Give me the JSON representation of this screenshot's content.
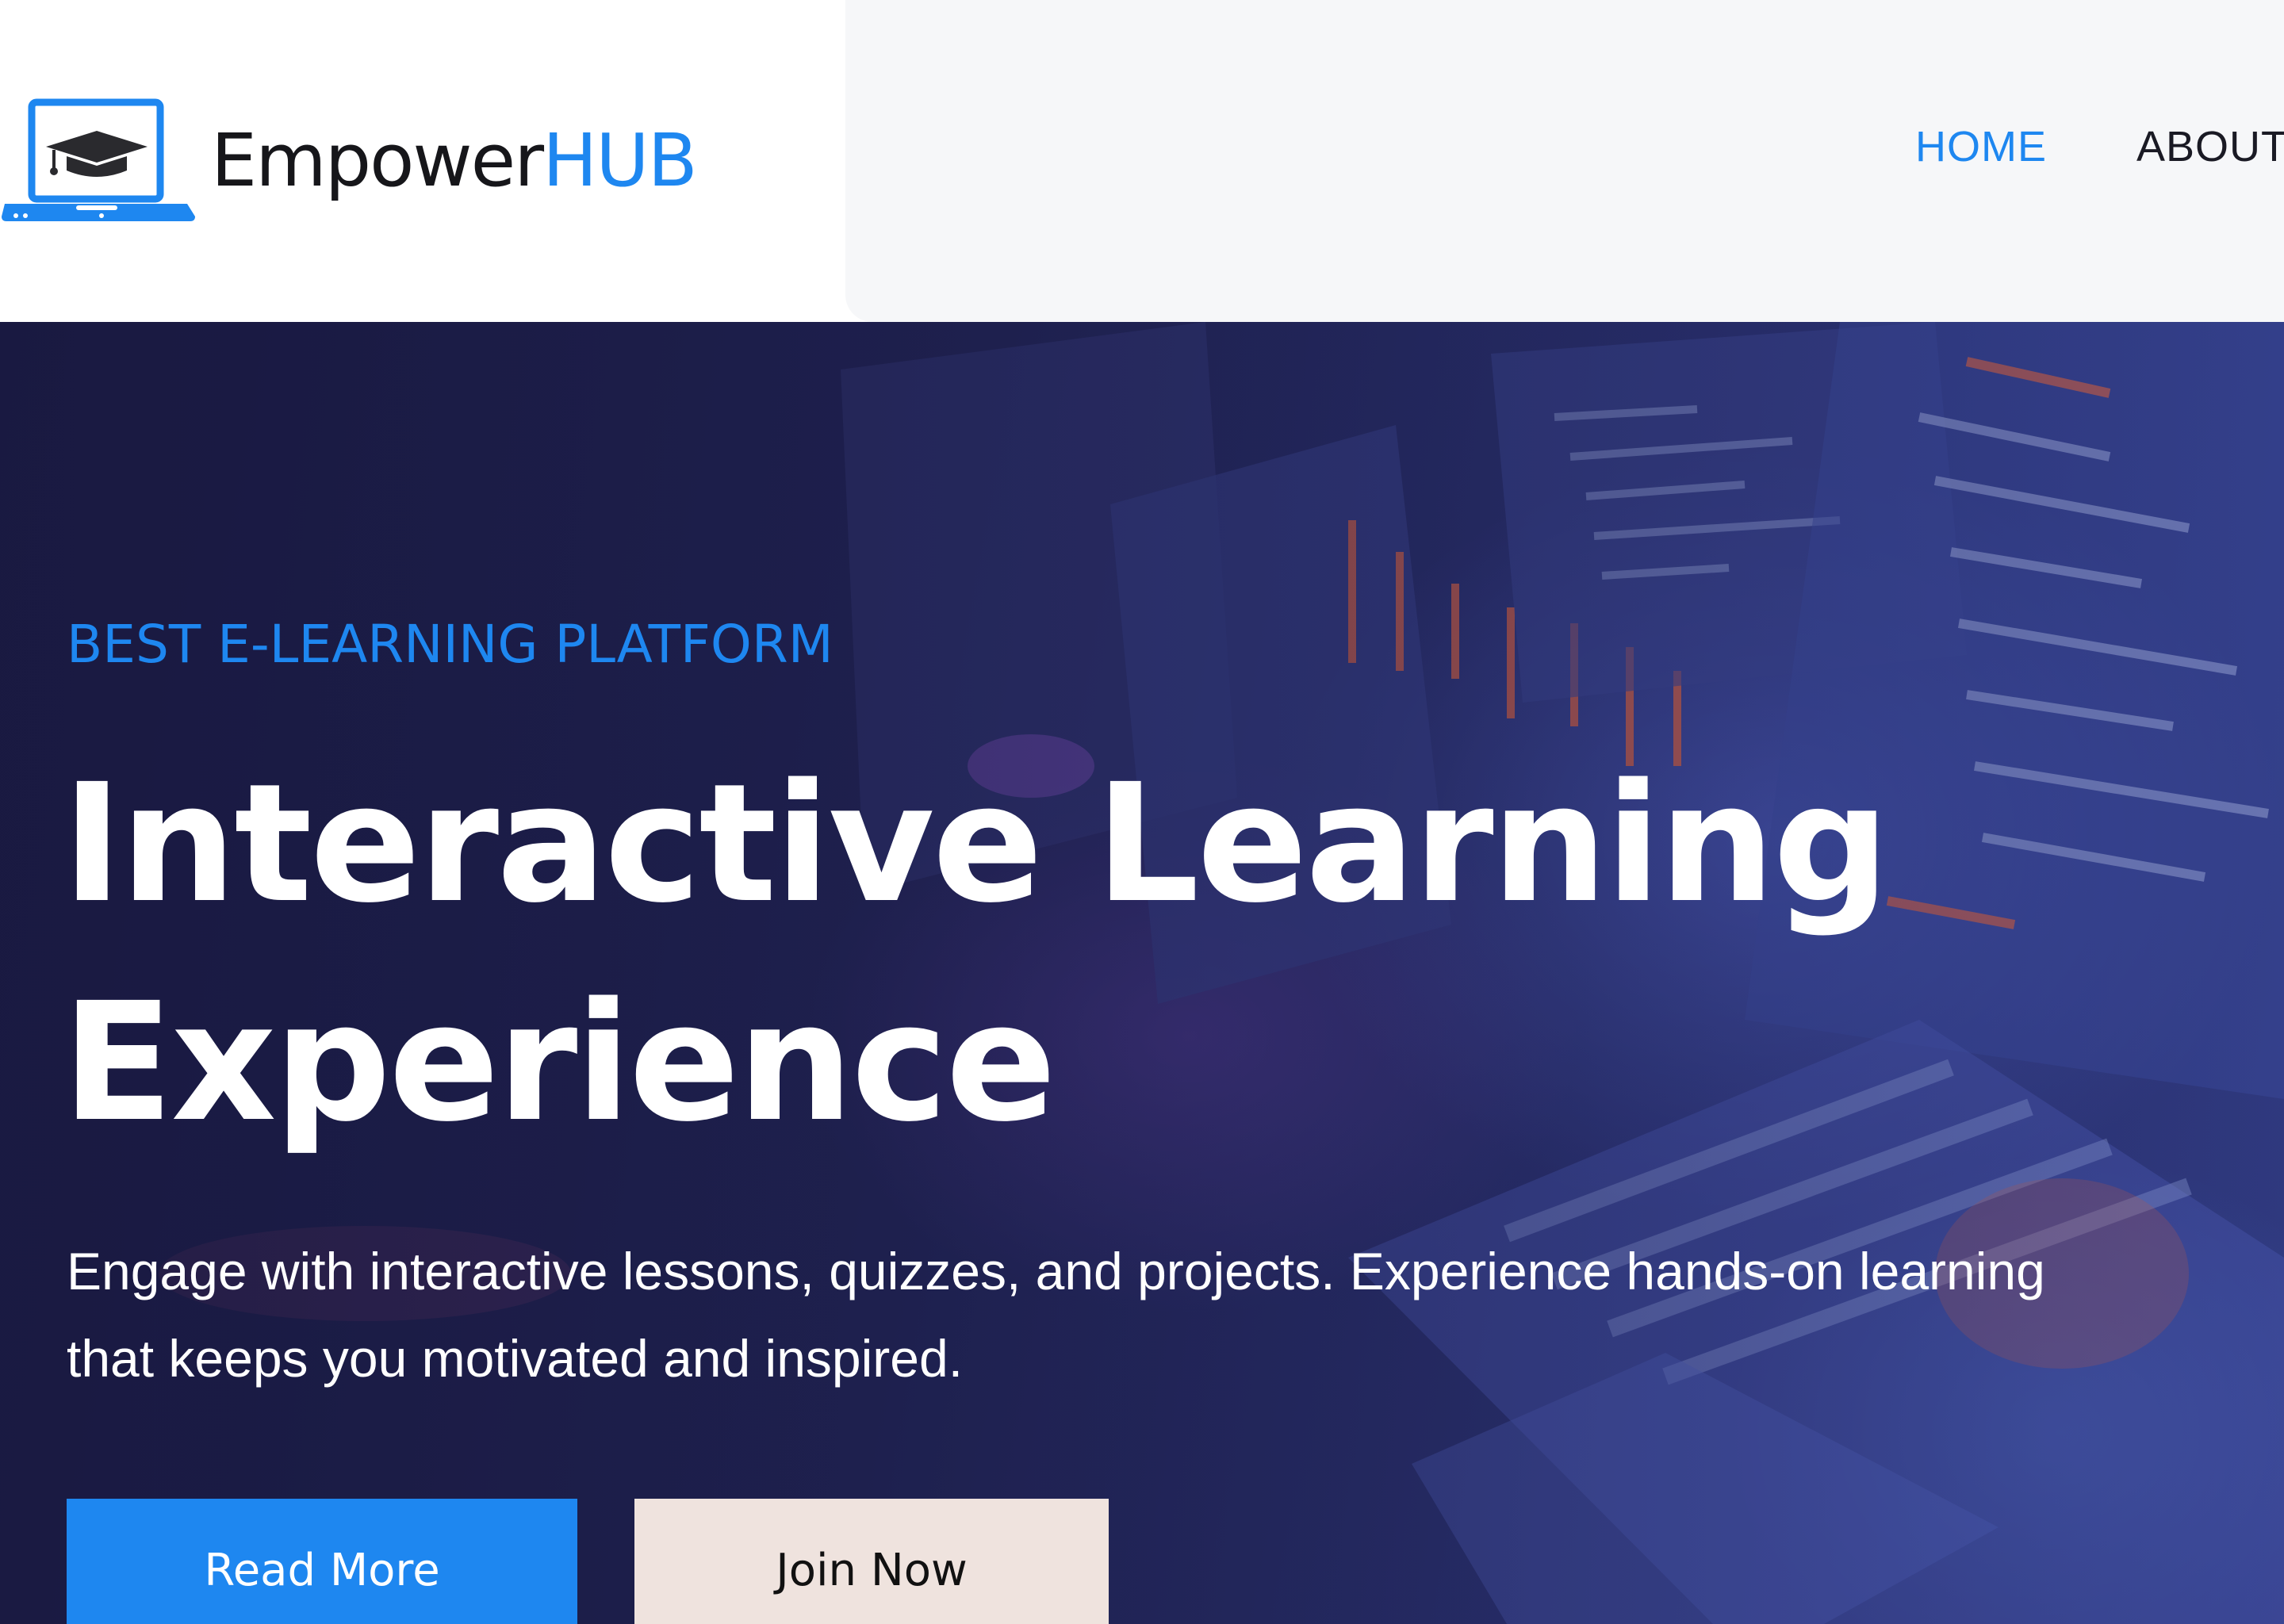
{
  "header": {
    "brand": {
      "part1": "Empower",
      "part2": "HUB"
    },
    "nav": [
      {
        "label": "HOME",
        "active": true
      },
      {
        "label": "ABOUT",
        "active": false
      }
    ]
  },
  "hero": {
    "eyebrow": "BEST E-LEARNING PLATFORM",
    "headline": "Interactive Learning Experience",
    "lead": "Engage with interactive lessons, quizzes, and projects. Experience hands-on learning that keeps you motivated and inspired.",
    "buttons": {
      "primary": "Read More",
      "secondary": "Join Now"
    }
  },
  "colors": {
    "accent": "#1e87f0",
    "hero_bg": "#23275c",
    "secondary_button": "#efe3de",
    "nav_panel": "#f6f7f9"
  },
  "icons": {
    "logo": "laptop-graduation-cap-icon"
  }
}
